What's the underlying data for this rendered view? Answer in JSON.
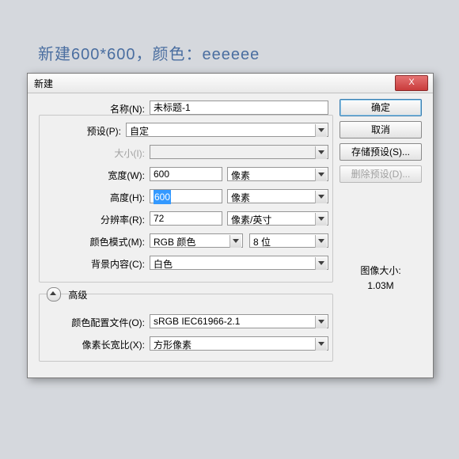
{
  "caption": "新建600*600，颜色：eeeeee",
  "dialog": {
    "title": "新建",
    "close": "X",
    "labels": {
      "name": "名称(N):",
      "preset": "预设(P):",
      "size": "大小(I):",
      "width": "宽度(W):",
      "height": "高度(H):",
      "resolution": "分辨率(R):",
      "colorMode": "颜色模式(M):",
      "bgContent": "背景内容(C):",
      "advanced": "高级",
      "profile": "颜色配置文件(O):",
      "aspect": "像素长宽比(X):"
    },
    "values": {
      "name": "未标题-1",
      "preset": "自定",
      "size": "",
      "width": "600",
      "widthUnit": "像素",
      "height": "600",
      "heightUnit": "像素",
      "resolution": "72",
      "resolutionUnit": "像素/英寸",
      "colorMode": "RGB 颜色",
      "depth": "8 位",
      "bgContent": "白色",
      "profile": "sRGB IEC61966-2.1",
      "aspect": "方形像素"
    },
    "buttons": {
      "ok": "确定",
      "cancel": "取消",
      "savePreset": "存储预设(S)...",
      "deletePreset": "删除预设(D)..."
    },
    "info": {
      "label": "图像大小:",
      "value": "1.03M"
    }
  }
}
